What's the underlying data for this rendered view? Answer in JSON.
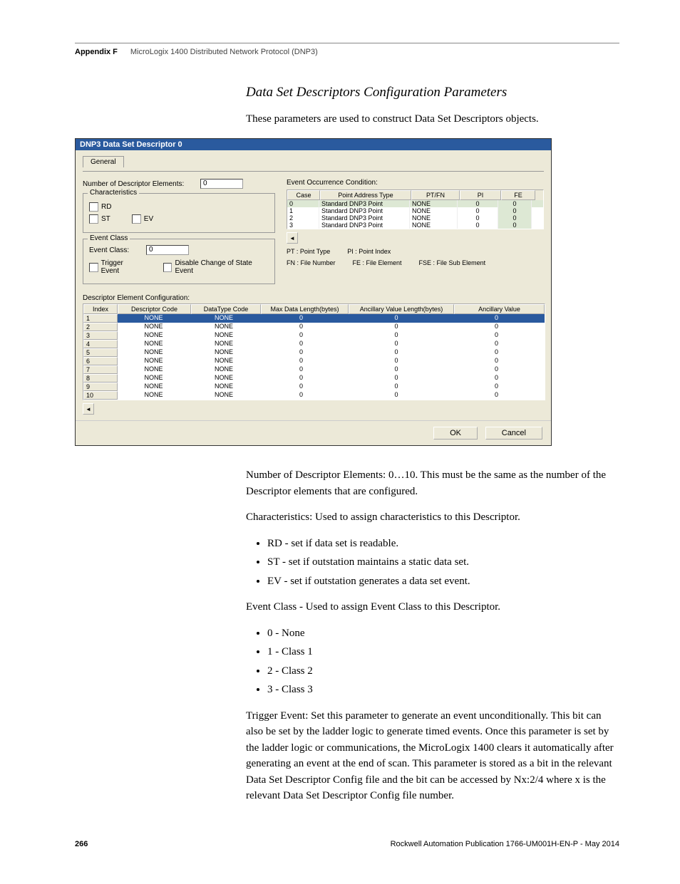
{
  "header": {
    "appendix": "Appendix F",
    "title": "MicroLogix 1400 Distributed Network Protocol (DNP3)"
  },
  "section_title": "Data Set Descriptors Configuration Parameters",
  "intro": "These parameters are used to construct Data Set Descriptors objects.",
  "dialog": {
    "title": "DNP3 Data Set Descriptor 0",
    "tab": "General",
    "num_elements_label": "Number of Descriptor Elements:",
    "num_elements_value": "0",
    "characteristics": {
      "title": "Characteristics",
      "rd": "RD",
      "st": "ST",
      "ev": "EV"
    },
    "event_class_group": {
      "title": "Event Class",
      "label": "Event Class:",
      "value": "0",
      "trigger": "Trigger Event",
      "disable": "Disable Change of State Event"
    },
    "occurrence": {
      "title": "Event Occurrence Condition:",
      "cols": {
        "case": "Case",
        "pat": "Point Address Type",
        "ptfn": "PT/FN",
        "pi": "PI",
        "fe": "FE"
      },
      "rows": [
        {
          "case": "0",
          "pat": "Standard DNP3 Point",
          "ptfn": "NONE",
          "pi": "0",
          "fe": "0"
        },
        {
          "case": "1",
          "pat": "Standard DNP3 Point",
          "ptfn": "NONE",
          "pi": "0",
          "fe": "0"
        },
        {
          "case": "2",
          "pat": "Standard DNP3 Point",
          "ptfn": "NONE",
          "pi": "0",
          "fe": "0"
        },
        {
          "case": "3",
          "pat": "Standard DNP3 Point",
          "ptfn": "NONE",
          "pi": "0",
          "fe": "0"
        }
      ],
      "legend": {
        "pt": "PT : Point Type",
        "pi": "PI : Point Index",
        "fn": "FN : File Number",
        "fe": "FE : File Element",
        "fse": "FSE : File Sub Element"
      }
    },
    "desc_config": {
      "label": "Descriptor Element Configuration:",
      "cols": {
        "idx": "Index",
        "dcode": "Descriptor Code",
        "dtype": "DataType Code",
        "maxlen": "Max Data Length(bytes)",
        "anclen": "Ancillary Value Length(bytes)",
        "ancval": "Ancillary Value"
      },
      "rows": [
        {
          "idx": "1",
          "dcode": "NONE",
          "dtype": "NONE",
          "maxlen": "0",
          "anclen": "0",
          "ancval": "0"
        },
        {
          "idx": "2",
          "dcode": "NONE",
          "dtype": "NONE",
          "maxlen": "0",
          "anclen": "0",
          "ancval": "0"
        },
        {
          "idx": "3",
          "dcode": "NONE",
          "dtype": "NONE",
          "maxlen": "0",
          "anclen": "0",
          "ancval": "0"
        },
        {
          "idx": "4",
          "dcode": "NONE",
          "dtype": "NONE",
          "maxlen": "0",
          "anclen": "0",
          "ancval": "0"
        },
        {
          "idx": "5",
          "dcode": "NONE",
          "dtype": "NONE",
          "maxlen": "0",
          "anclen": "0",
          "ancval": "0"
        },
        {
          "idx": "6",
          "dcode": "NONE",
          "dtype": "NONE",
          "maxlen": "0",
          "anclen": "0",
          "ancval": "0"
        },
        {
          "idx": "7",
          "dcode": "NONE",
          "dtype": "NONE",
          "maxlen": "0",
          "anclen": "0",
          "ancval": "0"
        },
        {
          "idx": "8",
          "dcode": "NONE",
          "dtype": "NONE",
          "maxlen": "0",
          "anclen": "0",
          "ancval": "0"
        },
        {
          "idx": "9",
          "dcode": "NONE",
          "dtype": "NONE",
          "maxlen": "0",
          "anclen": "0",
          "ancval": "0"
        },
        {
          "idx": "10",
          "dcode": "NONE",
          "dtype": "NONE",
          "maxlen": "0",
          "anclen": "0",
          "ancval": "0"
        }
      ]
    },
    "ok": "OK",
    "cancel": "Cancel"
  },
  "body": {
    "p1": "Number of Descriptor Elements: 0…10. This must be the same as the number of the Descriptor elements that are configured.",
    "p2": "Characteristics: Used to assign characteristics to this Descriptor.",
    "b1": "RD - set if data set is readable.",
    "b2": "ST - set if outstation maintains a static data set.",
    "b3": "EV - set if outstation generates a data set event.",
    "p3": "Event Class - Used to assign Event Class to this Descriptor.",
    "c1": "0 - None",
    "c2": "1 - Class 1",
    "c3": "2 - Class 2",
    "c4": "3 - Class 3",
    "p4": "Trigger Event: Set this parameter to generate an event unconditionally. This bit can also be set by the ladder logic to generate timed events. Once this parameter is set by the ladder logic or communications, the MicroLogix 1400 clears it automatically after generating an event at the end of scan. This parameter is stored as a bit in the relevant Data Set Descriptor Config file and the bit can be accessed by Nx:2/4 where x is the relevant Data Set Descriptor Config file number."
  },
  "footer": {
    "page": "266",
    "pub": "Rockwell Automation Publication 1766-UM001H-EN-P - May 2014"
  }
}
